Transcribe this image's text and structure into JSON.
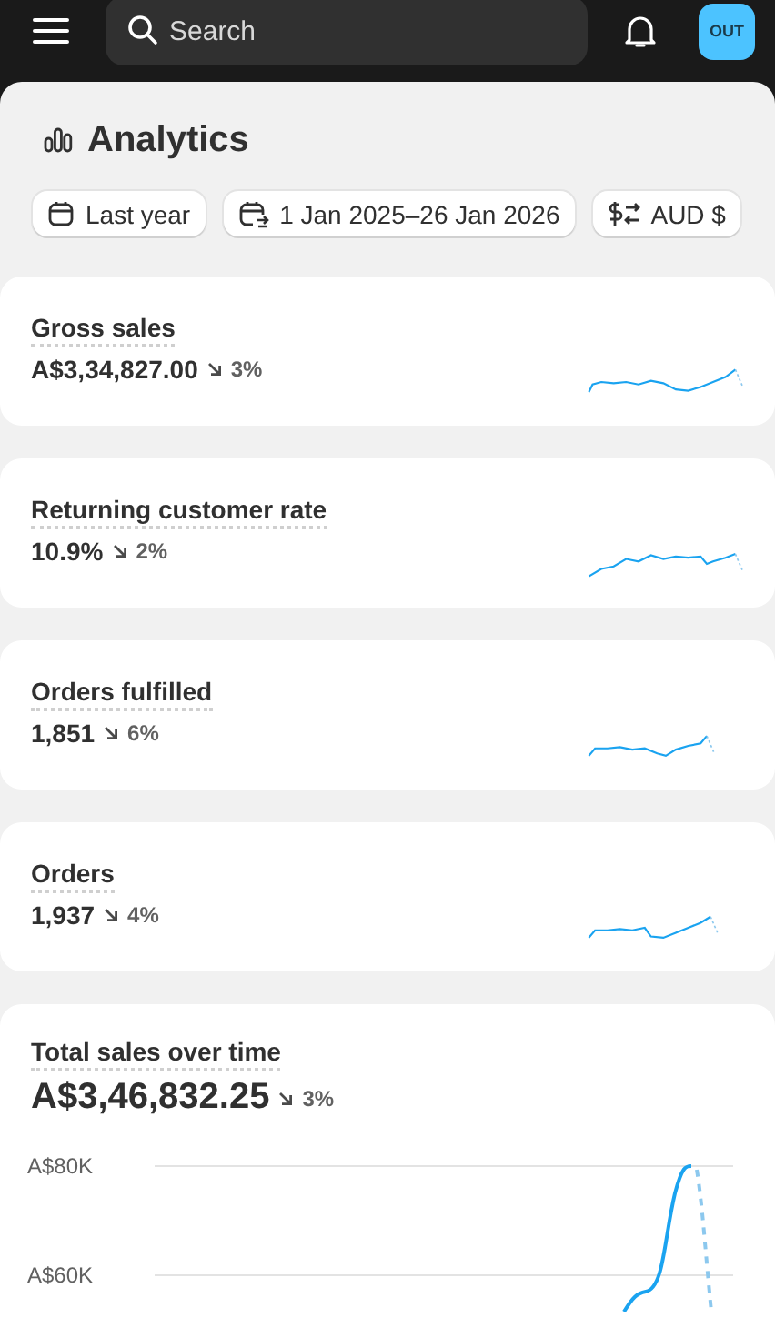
{
  "top_bar": {
    "search": {
      "placeholder": "Search"
    },
    "avatar": "OUT"
  },
  "page": {
    "title": "Analytics"
  },
  "filters": [
    {
      "kind": "calendar",
      "label": "Last year"
    },
    {
      "kind": "compare",
      "label": "1 Jan 2025–26 Jan 2026"
    },
    {
      "kind": "currency",
      "label": "AUD $"
    }
  ],
  "metrics": [
    {
      "title": "Gross sales",
      "value": "A$3,34,827.00",
      "decrease": true,
      "change": "3%"
    },
    {
      "title": "Returning customer rate",
      "value": "10.9%",
      "decrease": true,
      "change": "2%"
    },
    {
      "title": "Orders fulfilled",
      "value": "1,851",
      "decrease": true,
      "change": "6%"
    },
    {
      "title": "Orders",
      "value": "1,937",
      "decrease": true,
      "change": "4%"
    }
  ],
  "sales_chart": {
    "title": "Total sales over time",
    "value": "A$3,46,832.25",
    "decrease": true,
    "change": "3%",
    "y_axis_labels": [
      "A$80K",
      "A$60K"
    ]
  }
}
